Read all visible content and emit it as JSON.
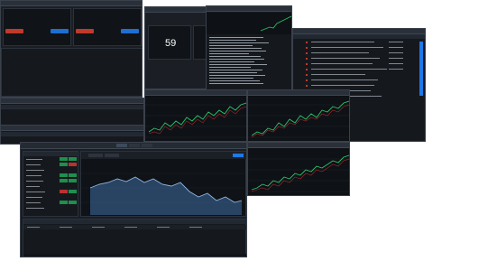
{
  "colors": {
    "up": "#2cc36b",
    "down": "#e0353b",
    "accent": "#1e78e6",
    "bg": "#1b1f25",
    "bar": "#2a3039"
  },
  "icons": [
    "close-icon",
    "minimize-icon",
    "maximize-icon"
  ]
}
